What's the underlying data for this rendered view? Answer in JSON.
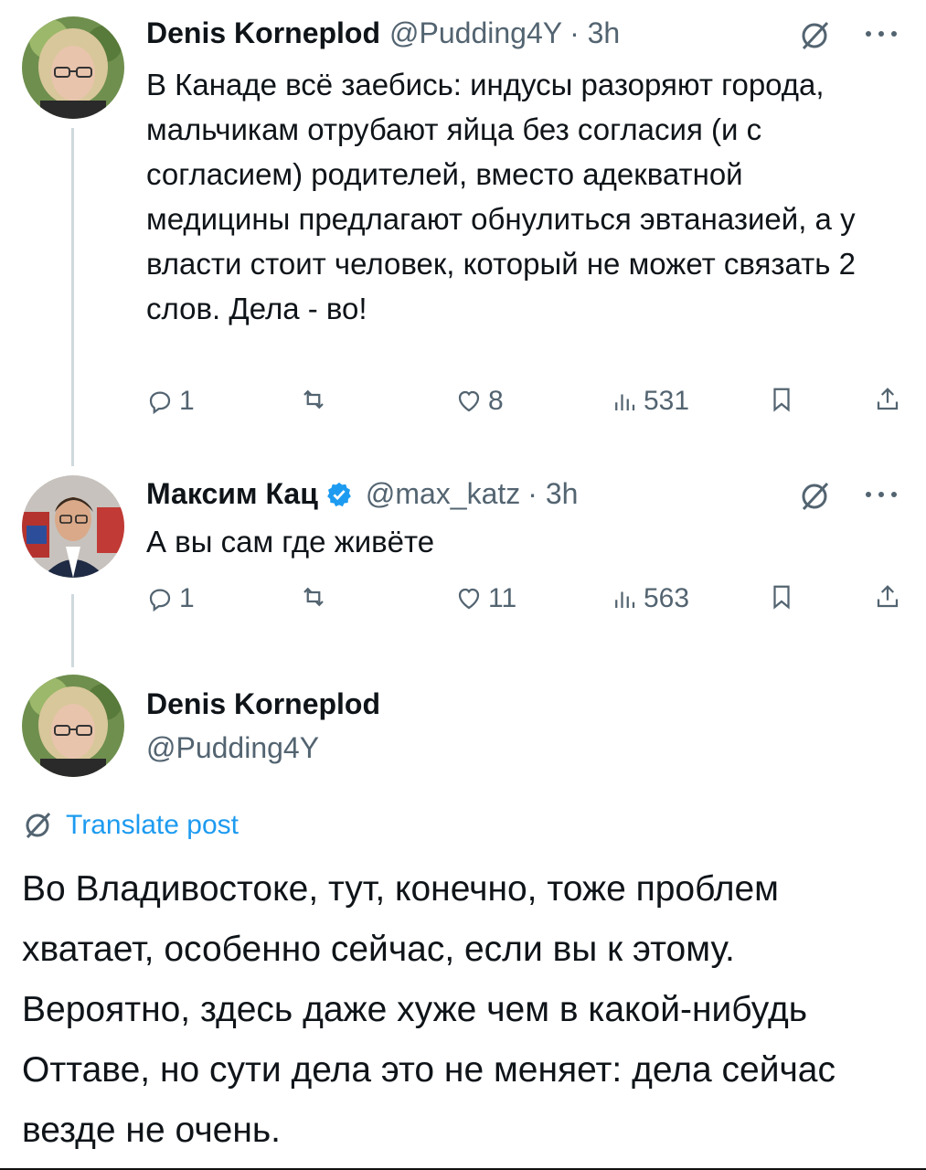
{
  "posts": [
    {
      "author": "Denis Korneplod",
      "handle": "@Pudding4Y",
      "time": "· 3h",
      "text": "В Канаде всё заебись: индусы разоряют города, мальчикам отрубают яйца без согласия (и с согласием) родителей, вместо адекватной медицины предлагают обнулиться эвтаназией, а у власти стоит человек, который не может связать 2 слов. Дела - во!",
      "replies": "1",
      "retweets": "",
      "likes": "8",
      "views": "531"
    },
    {
      "author": "Максим Кац",
      "handle": "@max_katz",
      "time": "· 3h",
      "verified": true,
      "text": "А вы сам где живёте",
      "replies": "1",
      "retweets": "",
      "likes": "11",
      "views": "563"
    }
  ],
  "main_post": {
    "author": "Denis Korneplod",
    "handle": "@Pudding4Y",
    "translate_label": "Translate post",
    "text": "Во Владивостоке, тут, конечно, тоже проблем хватает, особенно сейчас, если вы к этому. Вероятно, здесь даже хуже чем в какой-нибудь Оттаве, но сути дела это не меняет: дела сейчас везде не очень."
  },
  "icons": {
    "reply": "reply-icon",
    "retweet": "retweet-icon",
    "like": "heart-icon",
    "views": "views-icon",
    "bookmark": "bookmark-icon",
    "share": "share-icon",
    "translate": "translate-icon",
    "more": "more-icon"
  },
  "colors": {
    "accent": "#1d9bf0",
    "muted": "#536471",
    "text": "#0f1419",
    "thread_line": "#cfd9de"
  }
}
